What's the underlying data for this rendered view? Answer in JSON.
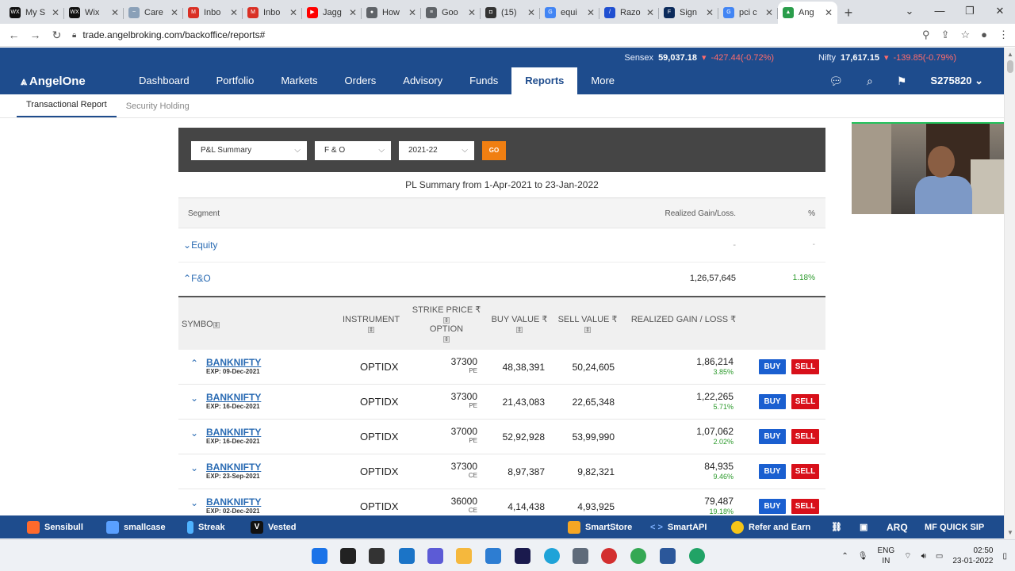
{
  "browser": {
    "tabs": [
      {
        "title": "My S",
        "color": "#111111",
        "glyph": "WX"
      },
      {
        "title": "Wix",
        "color": "#111111",
        "glyph": "WX"
      },
      {
        "title": "Care",
        "color": "#8aa0b8",
        "glyph": "~"
      },
      {
        "title": "Inbo",
        "color": "#d93025",
        "glyph": "M"
      },
      {
        "title": "Inbo",
        "color": "#d93025",
        "glyph": "M"
      },
      {
        "title": "Jagg",
        "color": "#ff0000",
        "glyph": "▶"
      },
      {
        "title": "How",
        "color": "#5f6368",
        "glyph": "●"
      },
      {
        "title": "Goo",
        "color": "#5f6368",
        "glyph": "≡"
      },
      {
        "title": "(15)",
        "color": "#333333",
        "glyph": "◘"
      },
      {
        "title": "equi",
        "color": "#4285f4",
        "glyph": "G"
      },
      {
        "title": "Razo",
        "color": "#1f4fd1",
        "glyph": "/"
      },
      {
        "title": "Sign",
        "color": "#0b2a5b",
        "glyph": "F"
      },
      {
        "title": "pci c",
        "color": "#4285f4",
        "glyph": "G"
      },
      {
        "title": "Ang",
        "color": "#2a9d4b",
        "glyph": "▲"
      }
    ],
    "url": "trade.angelbroking.com/backoffice/reports#"
  },
  "ticker": {
    "sensex_label": "Sensex",
    "sensex_value": "59,037.18",
    "sensex_change": "-427.44(-0.72%)",
    "nifty_label": "Nifty",
    "nifty_value": "17,617.15",
    "nifty_change": "-139.85(-0.79%)"
  },
  "nav": {
    "logo": "AngelOne",
    "items": [
      "Dashboard",
      "Portfolio",
      "Markets",
      "Orders",
      "Advisory",
      "Funds",
      "Reports",
      "More"
    ],
    "active": "Reports",
    "account": "S275820"
  },
  "subnav": {
    "tabs": [
      "Transactional Report",
      "Security Holding"
    ]
  },
  "filters": {
    "report_type": "P&L Summary",
    "segment": "F & O",
    "year": "2021-22",
    "go_label": "GO"
  },
  "summary_title": "PL Summary from 1-Apr-2021 to 23-Jan-2022",
  "segment_header": {
    "segment": "Segment",
    "gain": "Realized Gain/Loss.",
    "pct": "%"
  },
  "segments": [
    {
      "name": "Equity",
      "value": "-",
      "pct": "-"
    },
    {
      "name": "F&O",
      "value": "1,26,57,645",
      "pct": "1.18%"
    }
  ],
  "table": {
    "headers": {
      "symbol": "SYMBO",
      "instrument": "INSTRUMENT",
      "strike": "STRIKE PRICE ₹",
      "option": "OPTION",
      "buy": "BUY VALUE ₹",
      "sell": "SELL VALUE ₹",
      "gain": "REALIZED GAIN / LOSS ₹"
    },
    "buy_label": "BUY",
    "sell_label": "SELL",
    "rows": [
      {
        "symbol": "BANKNIFTY",
        "expiry": "EXP: 09-Dec-2021",
        "instrument": "OPTIDX",
        "strike": "37300",
        "option": "PE",
        "buy": "48,38,391",
        "sell": "50,24,605",
        "gain": "1,86,214",
        "pct": "3.85%",
        "chevron": "⌃"
      },
      {
        "symbol": "BANKNIFTY",
        "expiry": "EXP: 16-Dec-2021",
        "instrument": "OPTIDX",
        "strike": "37300",
        "option": "PE",
        "buy": "21,43,083",
        "sell": "22,65,348",
        "gain": "1,22,265",
        "pct": "5.71%",
        "chevron": "⌄"
      },
      {
        "symbol": "BANKNIFTY",
        "expiry": "EXP: 16-Dec-2021",
        "instrument": "OPTIDX",
        "strike": "37000",
        "option": "PE",
        "buy": "52,92,928",
        "sell": "53,99,990",
        "gain": "1,07,062",
        "pct": "2.02%",
        "chevron": "⌄"
      },
      {
        "symbol": "BANKNIFTY",
        "expiry": "EXP: 23-Sep-2021",
        "instrument": "OPTIDX",
        "strike": "37300",
        "option": "CE",
        "buy": "8,97,387",
        "sell": "9,82,321",
        "gain": "84,935",
        "pct": "9.46%",
        "chevron": "⌄"
      },
      {
        "symbol": "BANKNIFTY",
        "expiry": "EXP: 02-Dec-2021",
        "instrument": "OPTIDX",
        "strike": "36000",
        "option": "CE",
        "buy": "4,14,438",
        "sell": "4,93,925",
        "gain": "79,487",
        "pct": "19.18%",
        "chevron": "⌄"
      }
    ]
  },
  "bottom_bar": {
    "left": [
      {
        "label": "Sensibull",
        "icon": "bull-icon",
        "color": "#ff6a2c"
      },
      {
        "label": "smallcase",
        "icon": "smallcase-icon",
        "color": "#5aa0ff"
      },
      {
        "label": "Streak",
        "icon": "streak-icon",
        "color": "#4fb3ff"
      },
      {
        "label": "Vested",
        "icon": "vested-icon",
        "color": "#111111"
      }
    ],
    "right": [
      {
        "label": "SmartStore",
        "icon": "smartstore-icon",
        "color": "#f5a623"
      },
      {
        "label": "SmartAPI",
        "icon": "code-icon",
        "color": "#7fb2ff"
      },
      {
        "label": "Refer and Earn",
        "icon": "rupee-coin-icon",
        "color": "#f5c518"
      }
    ],
    "arq": "ARQ",
    "mf": "MF QUICK SIP"
  },
  "taskbar": {
    "lang": "ENG",
    "region": "IN",
    "time": "02:50",
    "date": "23-01-2022",
    "colors": {
      "win": "#1a73e8",
      "search": "#222222",
      "taskview": "#333333",
      "widgets": "#1b74c7",
      "chat": "#5c5bd6",
      "explorer": "#f5b83d",
      "store": "#2d7dd2",
      "terminal": "#1a1a4d",
      "edge": "#1fa3d8",
      "calc": "#5f6b7a",
      "opera": "#d32f2f",
      "chrome": "#34a853",
      "word": "#2b579a",
      "edgedev": "#21a366"
    }
  }
}
